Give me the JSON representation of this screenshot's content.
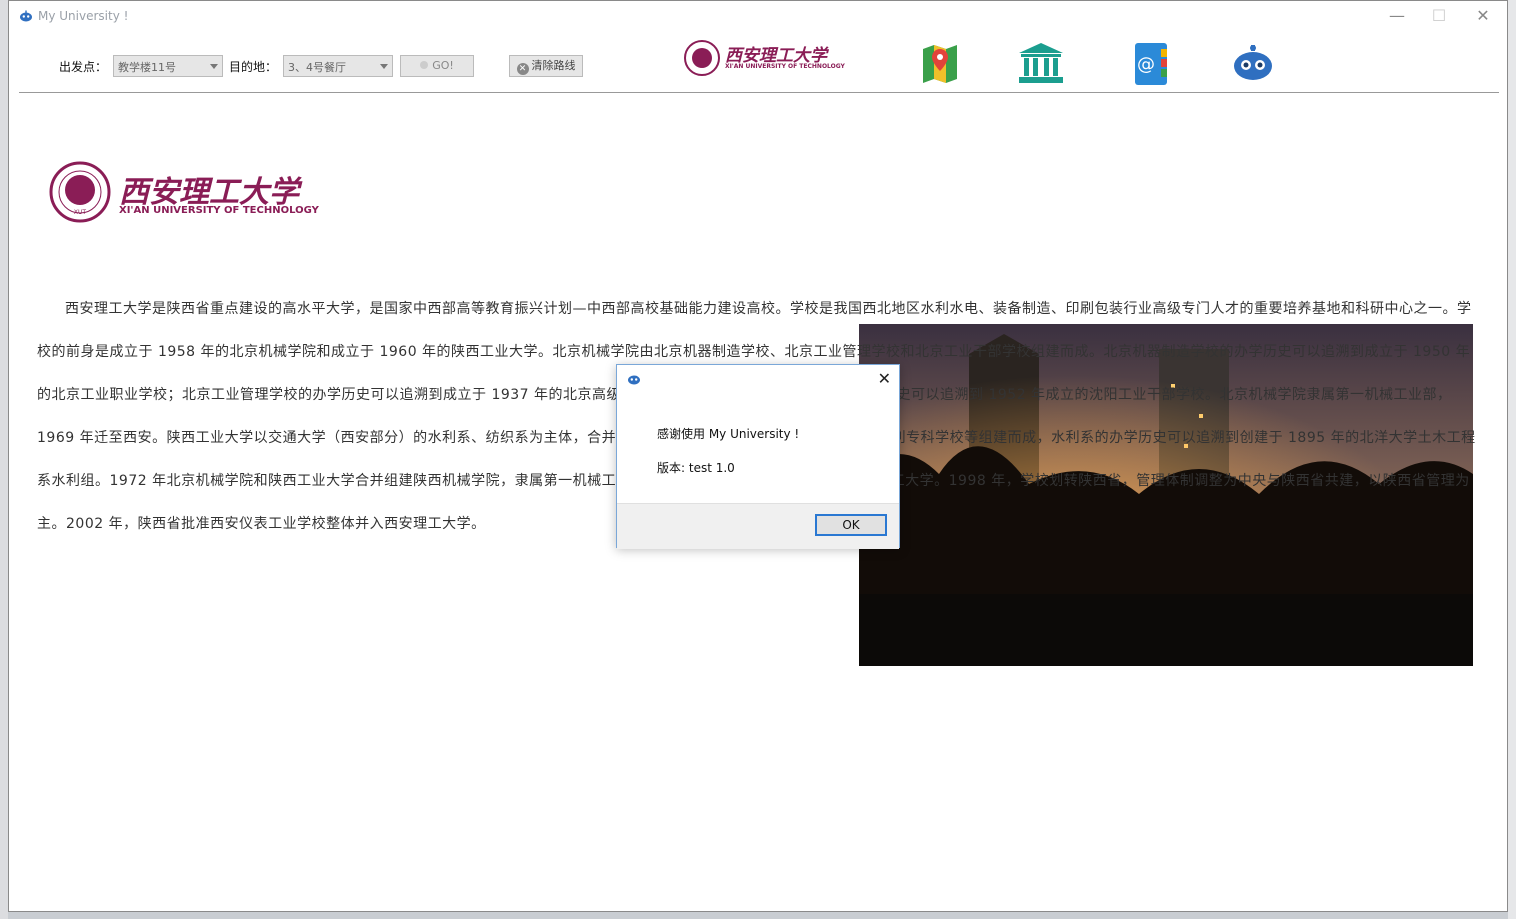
{
  "window": {
    "title": "My University !",
    "minimize": "—",
    "maximize": "☐",
    "close": "✕"
  },
  "toolbar": {
    "origin_label": "出发点：",
    "origin_value": "教学楼11号",
    "dest_label": "目的地：",
    "dest_value": "3、4号餐厅",
    "go_label": "GO!",
    "clear_label": "清除路线"
  },
  "logo": {
    "cn": "西安理工大学",
    "en": "XI'AN UNIVERSITY OF TECHNOLOGY",
    "badge": "XUT"
  },
  "article": {
    "text": "西安理工大学是陕西省重点建设的高水平大学，是国家中西部高等教育振兴计划—中西部高校基础能力建设高校。学校是我国西北地区水利水电、装备制造、印刷包装行业高级专门人才的重要培养基地和科研中心之一。学校的前身是成立于 1958 年的北京机械学院和成立于 1960 年的陕西工业大学。北京机械学院由北京机器制造学校、北京工业管理学校和北京工业干部学校组建而成。北京机器制造学校的办学历史可以追溯到成立于 1950 年的北京工业职业学校；北京工业管理学校的办学历史可以追溯到成立于 1937 年的北京高级商业职业学校；北京工业干部学校的办学历史可以追溯到 1952 年成立的沈阳工业干部学校。北京机械学院隶属第一机械工业部，1969 年迁至西安。陕西工业大学以交通大学（西安部分）的水利系、纺织系为主体，合并西安化工学校、西安仪表工业学校、西安水利专科学校等组建而成，水利系的办学历史可以追溯到创建于 1895 年的北洋大学土木工程系水利组。1972 年北京机械学院和陕西工业大学合并组建陕西机械学院，隶属第一机械工业部。1994 年，学校经批准更名为西安理工大学。1998 年，学校划转陕西省，管理体制调整为中央与陕西省共建，以陕西省管理为主。2002 年，陕西省批准西安仪表工业学校整体并入西安理工大学。"
  },
  "dialog": {
    "message": "感谢使用 My University !",
    "version": "版本: test 1.0",
    "ok": "OK",
    "close": "✕"
  },
  "icons": [
    "map-icon",
    "museum-icon",
    "contacts-icon",
    "robot-icon"
  ],
  "colors": {
    "brand": "#8a1d56",
    "accent": "#2a78d2"
  }
}
